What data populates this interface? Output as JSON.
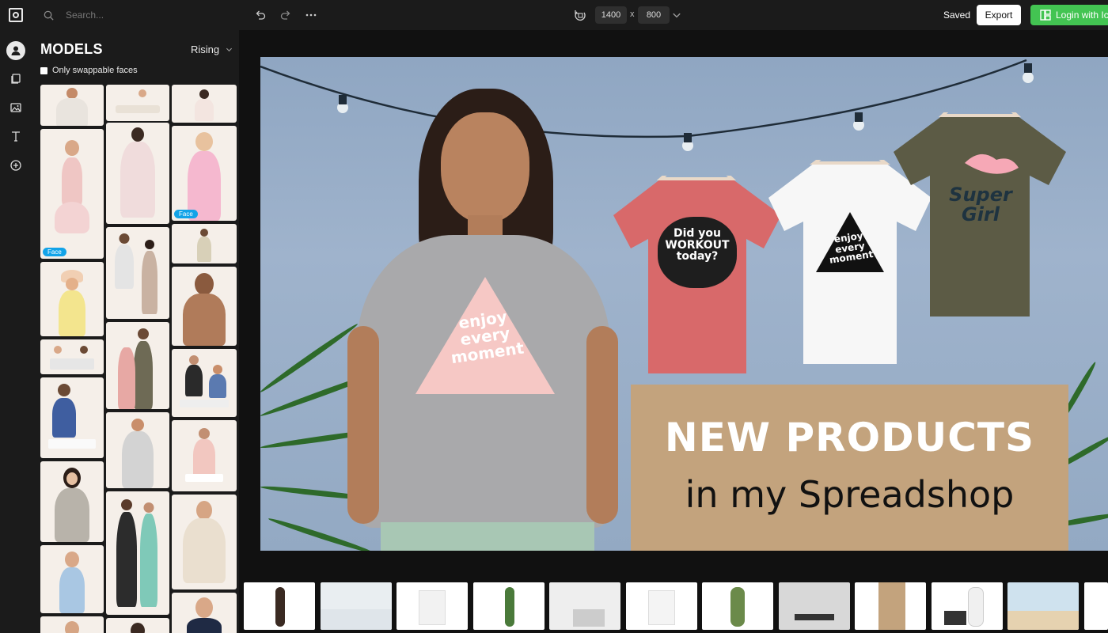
{
  "search": {
    "placeholder": "Search..."
  },
  "panel": {
    "title": "MODELS",
    "sort_label": "Rising",
    "swap_filter_label": "Only swappable faces",
    "badge_label": "Face"
  },
  "topbar": {
    "width": "1400",
    "height": "800",
    "times": "x",
    "saved": "Saved",
    "export_label": "Export",
    "login_label": "Login with Ic"
  },
  "canvas": {
    "headline": "NEW PRODUCTS",
    "subheadline": "in my Spreadshop",
    "shirt_print_main": "enjoy every moment",
    "shirt_print_red": "Did you WORKOUT today?",
    "shirt_print_white": "enjoy every moment",
    "shirt_print_green": "Super Girl"
  },
  "colors": {
    "accent_green": "#43c452",
    "badge_blue": "#12a3e8",
    "background": "#1b1b1b"
  },
  "icons": [
    "logo-icon",
    "user-icon",
    "pages-icon",
    "image-icon",
    "text-icon",
    "add-icon",
    "search-icon",
    "undo-icon",
    "redo-icon",
    "more-icon",
    "rotate-icon",
    "chevron-down-icon",
    "icons8-logo-icon"
  ]
}
